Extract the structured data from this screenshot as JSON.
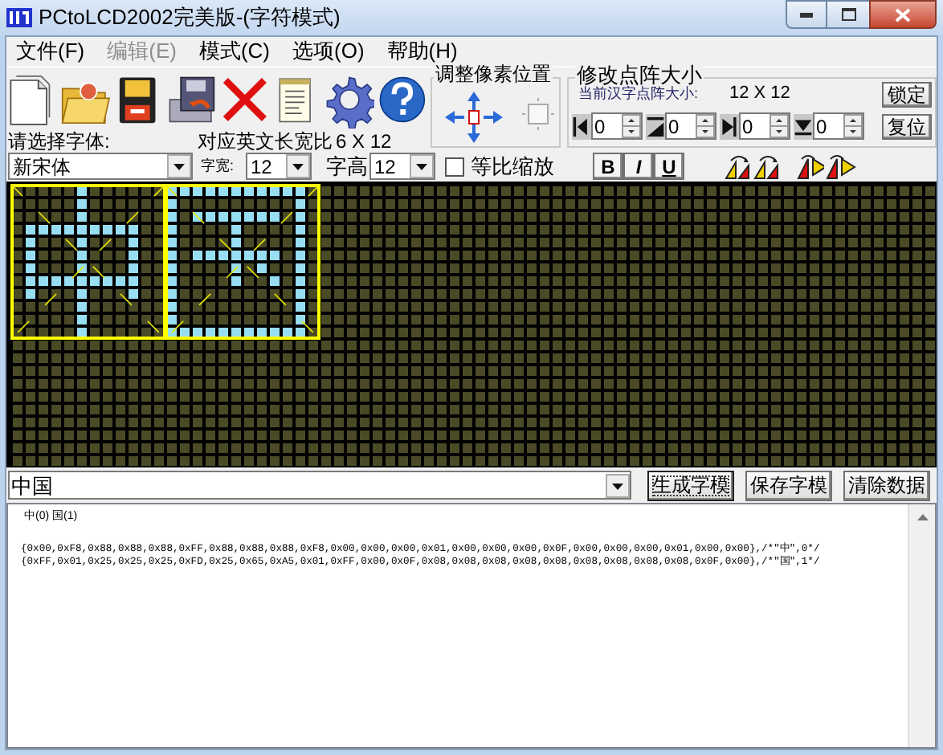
{
  "window": {
    "title": "PCtoLCD2002完美版-(字符模式)"
  },
  "menu": [
    {
      "label": "文件(F)",
      "disabled": false
    },
    {
      "label": "编辑(E)",
      "disabled": true
    },
    {
      "label": "模式(C)",
      "disabled": false
    },
    {
      "label": "选项(O)",
      "disabled": false
    },
    {
      "label": "帮助(H)",
      "disabled": false
    }
  ],
  "pixel_adjust": {
    "title": "调整像素位置"
  },
  "matrix_size": {
    "title": "修改点阵大小",
    "current_label": "当前汉字点阵大小:",
    "current_value": "12 X 12",
    "lock_button": "锁定",
    "reset_button": "复位",
    "spinners": [
      {
        "kind": "left",
        "value": "0"
      },
      {
        "kind": "top",
        "value": "0"
      },
      {
        "kind": "right",
        "value": "0"
      },
      {
        "kind": "bottom",
        "value": "0"
      }
    ]
  },
  "font": {
    "label": "请选择字体:",
    "value": "新宋体",
    "ratio_label": "对应英文长宽比",
    "ratio_value": "6 X 12",
    "width_label": "字宽:",
    "width_value": "12",
    "height_label": "字高",
    "height_value": "12",
    "proportional": {
      "label": "等比缩放",
      "checked": false
    },
    "style_buttons": [
      {
        "label": "B",
        "kind": "bold"
      },
      {
        "label": "I",
        "kind": "italic"
      },
      {
        "label": "U",
        "kind": "underline"
      }
    ]
  },
  "input": {
    "value": "中国"
  },
  "buttons": [
    {
      "label": "生成字模",
      "focused": true
    },
    {
      "label": "保存字模",
      "focused": false
    },
    {
      "label": "清除数据",
      "focused": false
    }
  ],
  "output": {
    "index_line": "中(0) 国(1)",
    "lines": [
      "{0x00,0xF8,0x88,0x88,0x88,0xFF,0x88,0x88,0x88,0xF8,0x00,0x00,0x00,0x01,0x00,0x00,0x00,0x0F,0x00,0x00,0x00,0x01,0x00,0x00},/*\"中\",0*/",
      "{0xFF,0x01,0x25,0x25,0x25,0xFD,0x25,0x65,0xA5,0x01,0xFF,0x00,0x0F,0x08,0x08,0x08,0x08,0x08,0x08,0x08,0x08,0x08,0x0F,0x00},/*\"国\",1*/"
    ]
  }
}
